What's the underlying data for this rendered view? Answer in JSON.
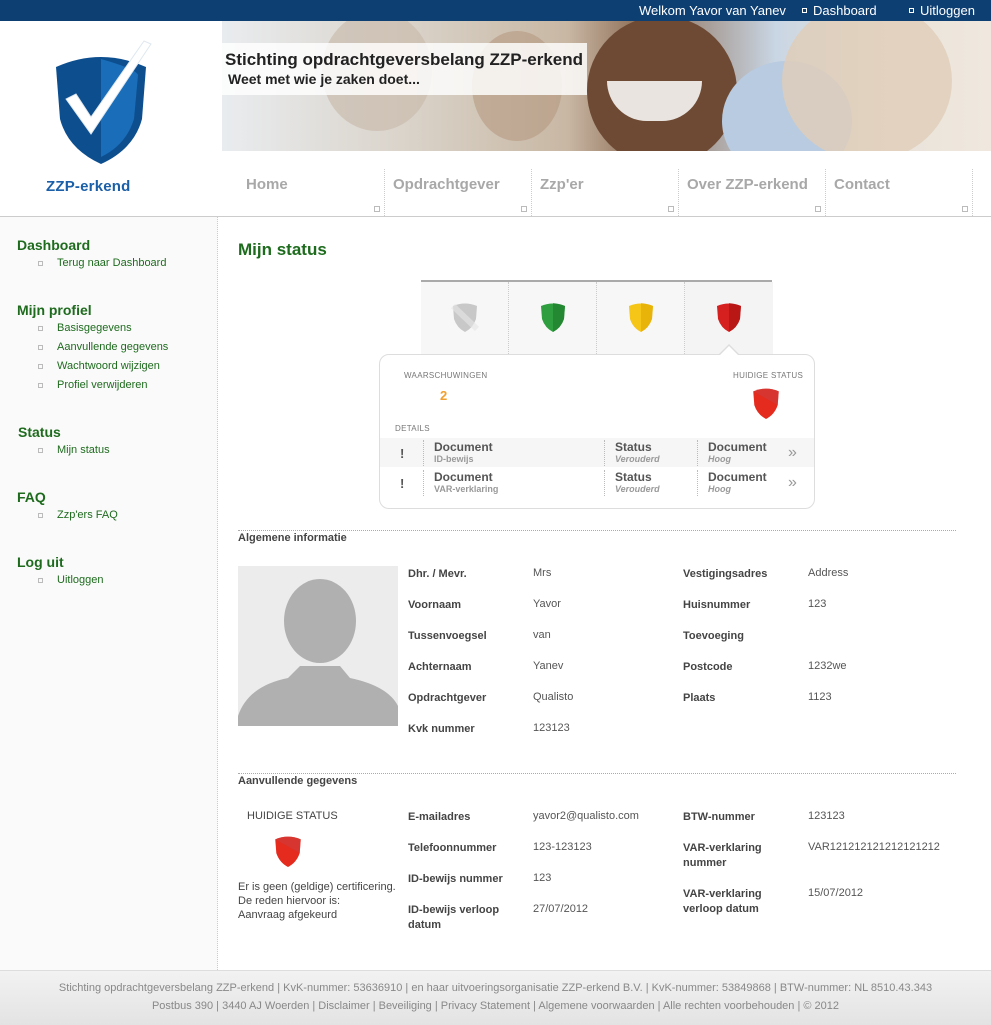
{
  "topbar": {
    "welcome": "Welkom Yavor van Yanev",
    "dashboard": "Dashboard",
    "logout": "Uitloggen"
  },
  "logo": {
    "text": "ZZP-erkend"
  },
  "banner": {
    "title": "Stichting opdrachtgeversbelang ZZP-erkend",
    "subtitle": "Weet met wie je zaken doet..."
  },
  "nav": {
    "items": [
      {
        "label": "Home"
      },
      {
        "label": "Opdrachtgever"
      },
      {
        "label": "Zzp'er"
      },
      {
        "label": "Over ZZP-erkend"
      },
      {
        "label": "Contact"
      }
    ]
  },
  "sidebar": {
    "groups": [
      {
        "title": "Dashboard",
        "items": [
          "Terug naar Dashboard"
        ]
      },
      {
        "title": "Mijn profiel",
        "items": [
          "Basisgegevens",
          "Aanvullende gegevens",
          "Wachtwoord wijzigen",
          "Profiel verwijderen"
        ]
      },
      {
        "title": "Status",
        "items": [
          "Mijn status"
        ]
      },
      {
        "title": "FAQ",
        "items": [
          "Zzp'ers FAQ"
        ]
      },
      {
        "title": "Log uit",
        "items": [
          "Uitloggen"
        ]
      }
    ]
  },
  "main": {
    "title": "Mijn status",
    "status_tabs": [
      {
        "color": "#c8c8c8",
        "dark": "#9a9a9a"
      },
      {
        "color": "#2e9e3e",
        "dark": "#1d7a2a"
      },
      {
        "color": "#f5c518",
        "dark": "#e0a800"
      },
      {
        "color": "#d62020",
        "dark": "#a51010"
      }
    ],
    "status_box": {
      "warnings_label": "WAARSCHUWINGEN",
      "warnings_count": "2",
      "current_status_label": "HUIDIGE STATUS",
      "details_label": "DETAILS",
      "rows": [
        {
          "excl": "!",
          "doc": "Document",
          "doc_sub": "ID-bewijs",
          "status": "Status",
          "status_sub": "Verouderd",
          "doc2": "Document",
          "doc2_sub": "Hoog",
          "chev": "»"
        },
        {
          "excl": "!",
          "doc": "Document",
          "doc_sub": "VAR-verklaring",
          "status": "Status",
          "status_sub": "Verouderd",
          "doc2": "Document",
          "doc2_sub": "Hoog",
          "chev": "»"
        }
      ]
    },
    "general": {
      "title": "Algemene informatie",
      "left": [
        {
          "label": "Dhr. / Mevr.",
          "value": "Mrs"
        },
        {
          "label": "Voornaam",
          "value": "Yavor"
        },
        {
          "label": "Tussenvoegsel",
          "value": "van"
        },
        {
          "label": "Achternaam",
          "value": "Yanev"
        },
        {
          "label": "Opdrachtgever",
          "value": "Qualisto"
        },
        {
          "label": "Kvk nummer",
          "value": "123123"
        }
      ],
      "right": [
        {
          "label": "Vestigingsadres",
          "value": "Address"
        },
        {
          "label": "Huisnummer",
          "value": "123"
        },
        {
          "label": "Toevoeging",
          "value": ""
        },
        {
          "label": "Postcode",
          "value": "1232we"
        },
        {
          "label": "Plaats",
          "value": "1123"
        }
      ]
    },
    "extra": {
      "title": "Aanvullende gegevens",
      "current_status_label": "HUIDIGE STATUS",
      "note_lines": [
        "Er is geen (geldige) certificering.",
        "De reden hiervoor is:",
        "Aanvraag afgekeurd"
      ],
      "left": [
        {
          "label": "E-mailadres",
          "value": "yavor2@qualisto.com"
        },
        {
          "label": "Telefoonnummer",
          "value": "123-123123"
        },
        {
          "label": "ID-bewijs nummer",
          "value": "123"
        },
        {
          "label_l1": "ID-bewijs verloop",
          "label_l2": "datum",
          "value": "27/07/2012"
        }
      ],
      "right": [
        {
          "label": "BTW-nummer",
          "value": "123123"
        },
        {
          "label_l1": "VAR-verklaring",
          "label_l2": "nummer",
          "value": "VAR121212121212121212"
        },
        {
          "label_l1": "VAR-verklaring",
          "label_l2": "verloop datum",
          "value": "15/07/2012"
        }
      ]
    }
  },
  "footer": {
    "line1": "Stichting opdrachtgeversbelang ZZP-erkend | KvK-nummer: 53636910 | en haar uitvoeringsorganisatie ZZP-erkend B.V. | KvK-nummer: 53849868 | BTW-nummer: NL 8510.43.343",
    "line2": "Postbus 390 | 3440 AJ Woerden | Disclaimer | Beveiliging | Privacy Statement | Algemene voorwaarden | Alle rechten voorbehouden | © 2012"
  }
}
